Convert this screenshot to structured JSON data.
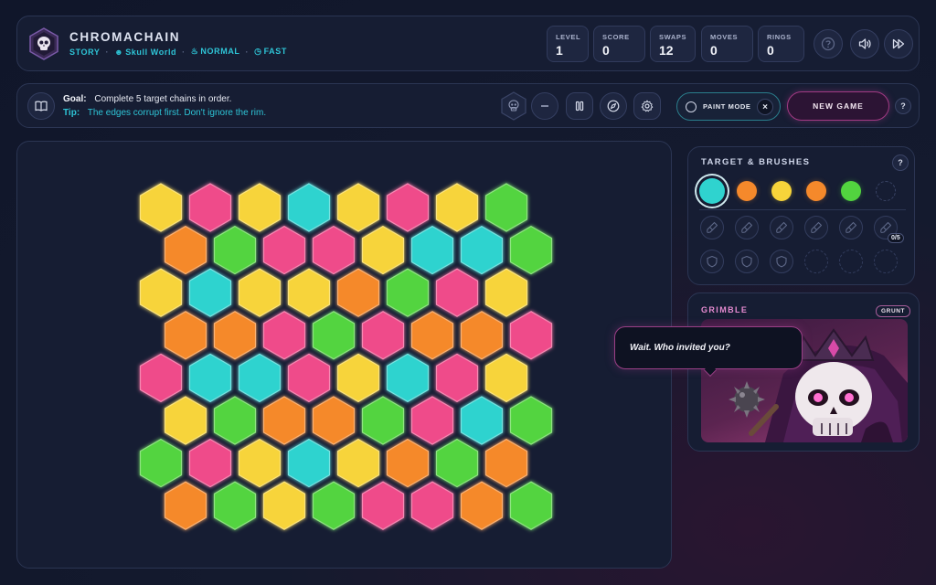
{
  "header": {
    "title": "CHROMACHAIN",
    "mode": "STORY",
    "world": "Skull World",
    "difficulty": "NORMAL",
    "speed": "FAST",
    "stats": [
      {
        "label": "LEVEL",
        "value": "1"
      },
      {
        "label": "SCORE",
        "value": "0"
      },
      {
        "label": "SWAPS",
        "value": "12"
      },
      {
        "label": "MOVES",
        "value": "0"
      },
      {
        "label": "RINGS",
        "value": "0"
      }
    ],
    "icons": [
      "help-icon",
      "volume-icon",
      "fast-forward-icon"
    ]
  },
  "goalbar": {
    "goal_label": "Goal:",
    "goal_text": "Complete 5 target chains in order.",
    "tip_label": "Tip:",
    "tip_text": "The edges corrupt first. Don't ignore the rim.",
    "paint_mode_label": "PAINT MODE",
    "paint_mode_close": "×",
    "new_game_label": "NEW GAME",
    "help": "?"
  },
  "colors": {
    "yellow": "#f7d43a",
    "pink": "#ef4b8a",
    "cyan": "#2fd3cf",
    "green": "#52d43f",
    "orange": "#f5892b",
    "accent": "#2ec4d6"
  },
  "board": {
    "rows": [
      [
        "yellow",
        "pink",
        "yellow",
        "cyan",
        "yellow",
        "pink",
        "yellow",
        "green"
      ],
      [
        "orange",
        "green",
        "pink",
        "pink",
        "yellow",
        "cyan",
        "cyan",
        "green"
      ],
      [
        "yellow",
        "cyan",
        "yellow",
        "yellow",
        "orange",
        "green",
        "pink",
        "yellow"
      ],
      [
        "orange",
        "orange",
        "pink",
        "green",
        "pink",
        "orange",
        "orange",
        "pink"
      ],
      [
        "pink",
        "cyan",
        "cyan",
        "pink",
        "yellow",
        "cyan",
        "pink",
        "yellow"
      ],
      [
        "yellow",
        "green",
        "orange",
        "orange",
        "green",
        "pink",
        "cyan",
        "green"
      ],
      [
        "green",
        "pink",
        "yellow",
        "cyan",
        "yellow",
        "orange",
        "green",
        "orange"
      ],
      [
        "orange",
        "green",
        "yellow",
        "green",
        "pink",
        "pink",
        "orange",
        "green"
      ]
    ]
  },
  "brushes": {
    "title": "TARGET & BRUSHES",
    "help": "?",
    "targets": [
      "cyan",
      "orange",
      "yellow",
      "orange",
      "green",
      "empty"
    ],
    "brush_slots": [
      "brush",
      "brush",
      "brush",
      "brush",
      "brush",
      "brush"
    ],
    "brush_count": "0/5",
    "shield_slots": [
      "shield",
      "shield",
      "shield",
      "empty",
      "empty",
      "empty"
    ]
  },
  "character": {
    "name": "GRIMBLE",
    "rank": "GRUNT",
    "speech": "Wait. Who invited you?"
  }
}
